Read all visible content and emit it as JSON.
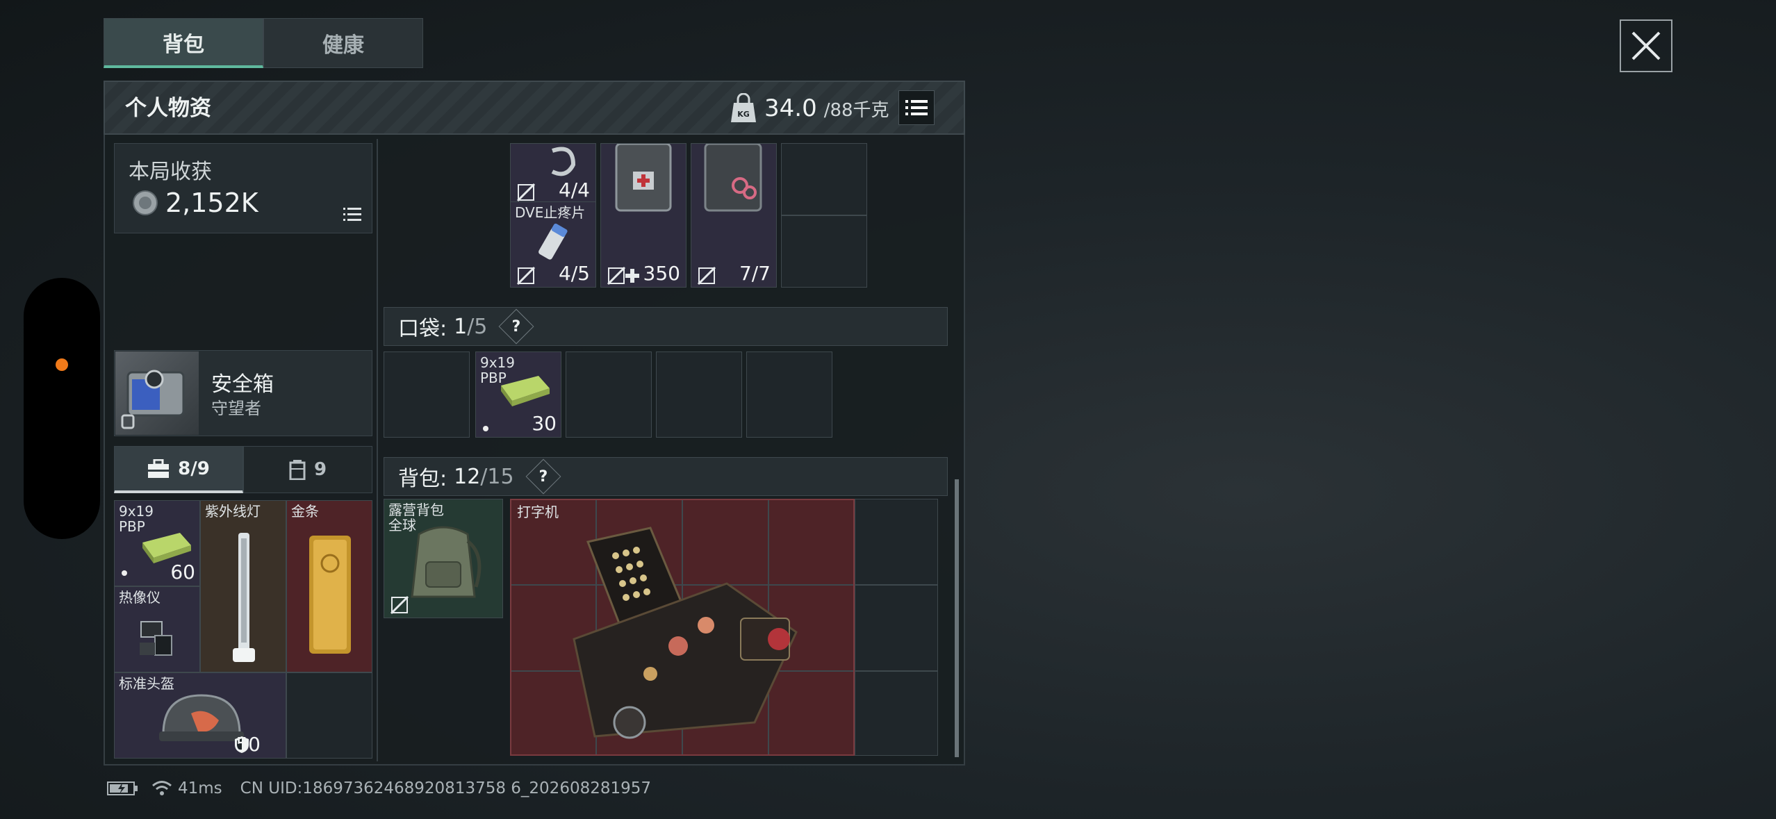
{
  "tabs": {
    "backpack": "背包",
    "health": "健康"
  },
  "panel": {
    "title": "个人物资",
    "weight_current": "34.0",
    "weight_max": "/88千克"
  },
  "harvest": {
    "label": "本局收获",
    "value": "2,152K"
  },
  "safebox": {
    "name": "安全箱",
    "subtitle": "守望者"
  },
  "segments": {
    "case_count": "8/9",
    "sack_count": "9"
  },
  "case_items": [
    {
      "label": "9x19\nPBP",
      "qty": "60"
    },
    {
      "label": "紫外线灯",
      "qty": ""
    },
    {
      "label": "金条",
      "qty": ""
    },
    {
      "label": "热像仪",
      "qty": ""
    },
    {
      "label": "标准头盔",
      "qty": "50"
    }
  ],
  "top_items": [
    {
      "label": "",
      "qty": "4/4"
    },
    {
      "label": "DVE止疼片",
      "qty": "4/5"
    },
    {
      "label": "",
      "qty": "350"
    },
    {
      "label": "",
      "qty": "7/7"
    }
  ],
  "pocket": {
    "label": "口袋:",
    "count": "1",
    "total": "/5",
    "item": {
      "label": "9x19\nPBP",
      "qty": "30"
    }
  },
  "backpack": {
    "label": "背包:",
    "count": "12",
    "total": "/15",
    "bag_item": {
      "label": "露营背包\n全球"
    },
    "typewriter": {
      "label": "打字机"
    }
  },
  "status": {
    "ping": "41ms",
    "uid": "CN UID:18697362468920813758 6_202608281957"
  },
  "colors": {
    "accent": "#5fb99e",
    "orange_dot": "#f07a1a",
    "valuable_red": "#4e2327"
  }
}
